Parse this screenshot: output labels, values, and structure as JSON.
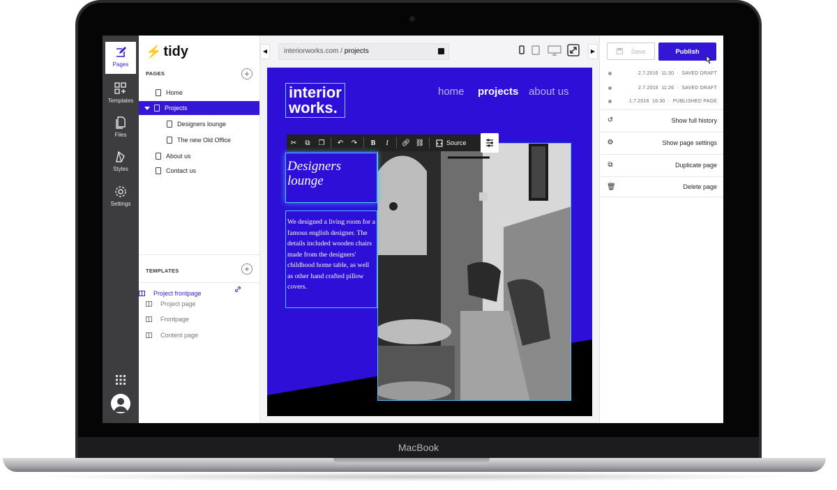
{
  "device": {
    "brand": "MacBook"
  },
  "rail": {
    "items": [
      {
        "label": "Pages",
        "icon": "pages-icon"
      },
      {
        "label": "Templates",
        "icon": "templates-icon"
      },
      {
        "label": "Files",
        "icon": "files-icon"
      },
      {
        "label": "Styles",
        "icon": "styles-icon"
      },
      {
        "label": "Settings",
        "icon": "settings-icon"
      }
    ]
  },
  "sidebar": {
    "logo": "tidy",
    "pages_title": "PAGES",
    "pages": [
      {
        "label": "Home"
      },
      {
        "label": "Projects"
      },
      {
        "label": "Designers lounge"
      },
      {
        "label": "The new Old Office"
      },
      {
        "label": "About us"
      },
      {
        "label": "Contact us"
      }
    ],
    "templates_title": "TEMPLATES",
    "templates": [
      {
        "label": "Project frontpage"
      },
      {
        "label": "Project page"
      },
      {
        "label": "Frontpage"
      },
      {
        "label": "Content page"
      }
    ]
  },
  "address": {
    "domain": "interiorworks.com / ",
    "path": "projects"
  },
  "site": {
    "logo": "interior\nworks.",
    "nav": [
      "home",
      "projects",
      "about us"
    ],
    "heading": "Designers lounge",
    "body": "We designed a living room for a famous english designer. The details included wooden chairs made from the designers' childhood home table, as well as other hand crafted pillow covers."
  },
  "editor_toolbar": {
    "source_label": "Source"
  },
  "actions": {
    "save_label": "Save",
    "publish_label": "Publish",
    "history": [
      {
        "date": "2.7.2016",
        "time": "11:30",
        "status": "SAVED DRAFT"
      },
      {
        "date": "2.7.2016",
        "time": "11:26",
        "status": "SAVED DRAFT"
      },
      {
        "date": "1.7.2016",
        "time": "16:30",
        "status": "PUBLISHED PAGE"
      }
    ],
    "menu": [
      {
        "label": "Show full history",
        "icon": "history-icon"
      },
      {
        "label": "Show page settings",
        "icon": "gear-icon"
      },
      {
        "label": "Duplicate page",
        "icon": "duplicate-icon"
      },
      {
        "label": "Delete page",
        "icon": "trash-icon"
      }
    ]
  },
  "colors": {
    "brand": "#3218d6",
    "preview_bg": "#2d0fd8",
    "rail_bg": "#3d3d3f"
  }
}
